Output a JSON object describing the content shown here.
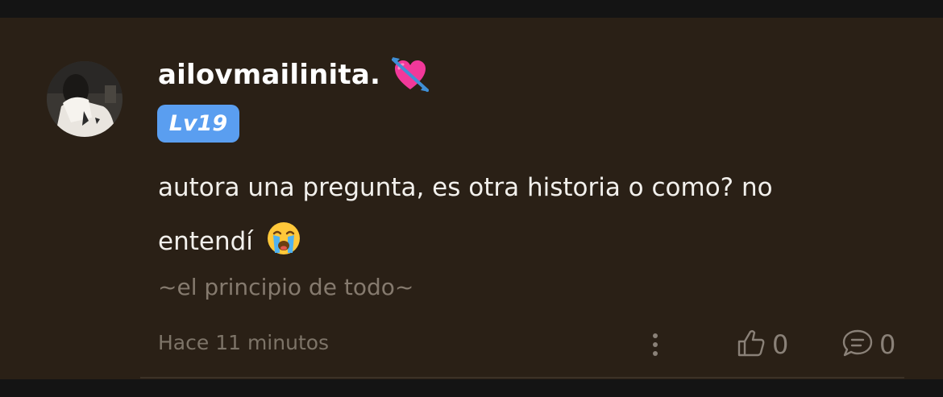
{
  "comment": {
    "username": "ailovmailinita.",
    "username_emoji": "heart-with-arrow-icon",
    "level": "Lv19",
    "text_line1": "autora una pregunta, es otra historia o como? no",
    "text_line2": "entendí",
    "text_emoji": "loudly-crying-face-icon",
    "story_name": "~el principio de todo~",
    "timestamp": "Hace 11 minutos",
    "likes": "0",
    "replies": "0"
  },
  "colors": {
    "background": "#141414",
    "card": "#2a2016",
    "badge": "#5a9ef0",
    "muted_text": "#857a6e"
  }
}
